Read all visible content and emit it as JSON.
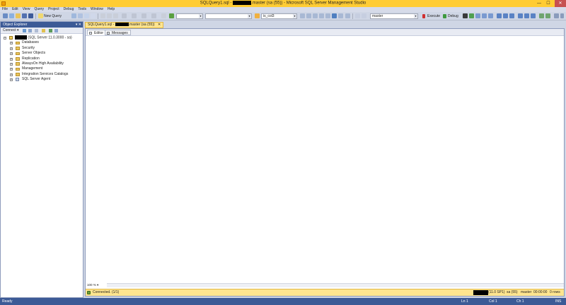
{
  "window": {
    "title_prefix": "SQLQuery1.sql - ",
    "title_suffix": ".master (sa (55)) - Microsoft SQL Server Management Studio",
    "minimize": "—",
    "maximize": "☐",
    "close": "✕"
  },
  "menu": [
    "File",
    "Edit",
    "View",
    "Query",
    "Project",
    "Debug",
    "Tools",
    "Window",
    "Help"
  ],
  "toolbar": {
    "new_query_label": "New Query",
    "db_combo_value": "master",
    "column_combo_value": "is_col3",
    "execute_label": "Execute",
    "debug_label": "Debug"
  },
  "object_explorer": {
    "title": "Object Explorer",
    "pin": "▾ ✕",
    "connect_label": "Connect ▾",
    "server_suffix": "(SQL Server 11.0.3000 - sa)",
    "items": [
      "Databases",
      "Security",
      "Server Objects",
      "Replication",
      "AlwaysOn High Availability",
      "Management",
      "Integration Services Catalogs",
      "SQL Server Agent"
    ]
  },
  "document": {
    "tab_prefix": "SQLQuery1.sql - ",
    "tab_suffix": ".master (sa (55))",
    "tab_close": "✕",
    "subtabs": [
      "Editor",
      "Messages"
    ],
    "zoom": "100 %",
    "zoom_arrow": "▾",
    "status_connected": "Connected. (1/1)",
    "status_version": "(11.0 SP1)",
    "status_user": "sa (55)",
    "status_db": "master",
    "status_time": "00:00:00",
    "status_rows": "0 rows"
  },
  "statusbar": {
    "ready": "Ready",
    "ln": "Ln 1",
    "col": "Col 1",
    "ch": "Ch 1",
    "ins": "INS"
  },
  "colors": {
    "title_bar": "#ffcc33",
    "accent_blue": "#3c5a96",
    "doc_tab": "#ffe58f"
  }
}
